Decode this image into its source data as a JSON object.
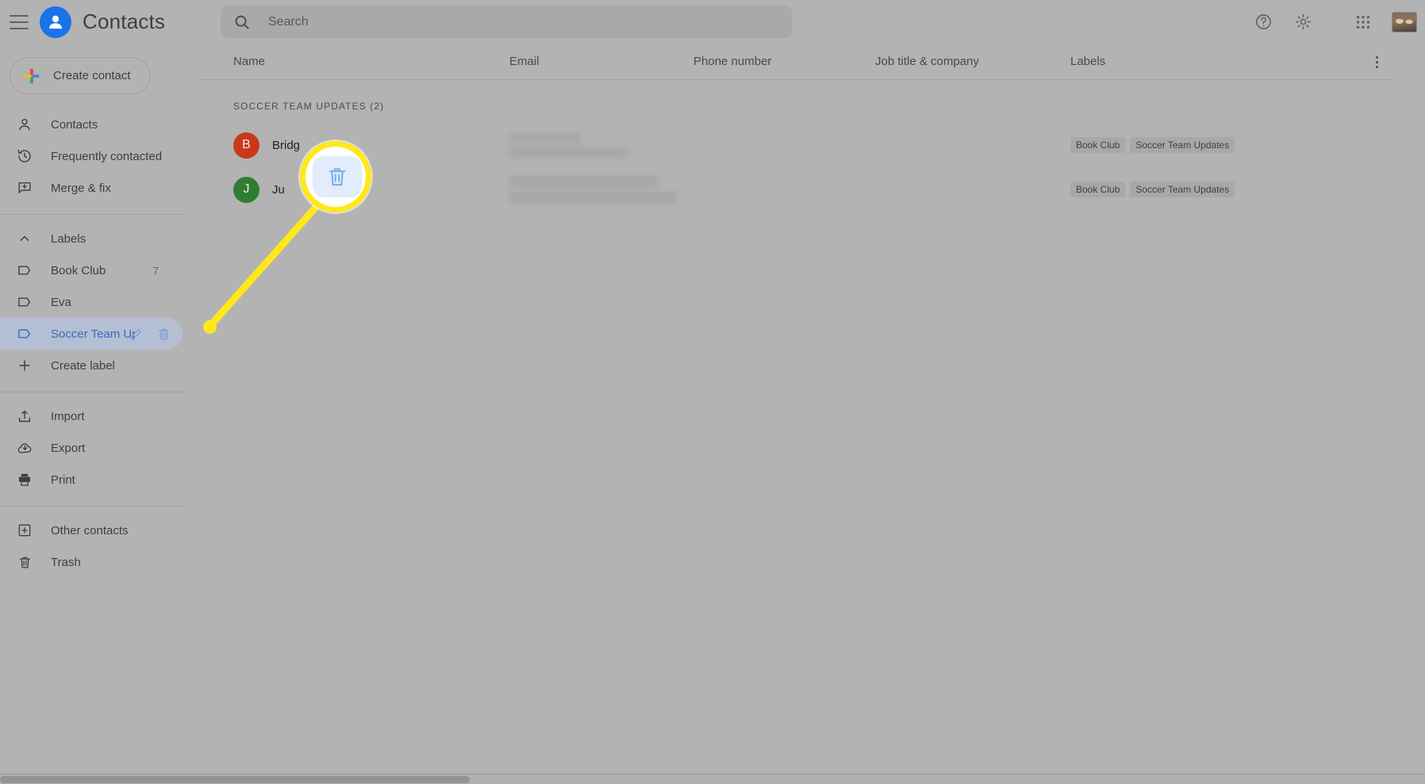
{
  "app": {
    "title": "Contacts",
    "brand_color": "#1a73e8"
  },
  "topbar": {
    "menu_icon": "hamburger-icon",
    "help_icon": "help-circle-icon",
    "settings_icon": "gear-icon",
    "apps_icon": "apps-grid-icon",
    "avatar_icon": "account-avatar"
  },
  "search": {
    "placeholder": "Search",
    "value": "",
    "icon": "search-icon"
  },
  "sidebar": {
    "create_contact_label": "Create contact",
    "nav": [
      {
        "label": "Contacts",
        "icon": "person-icon",
        "selected": false
      },
      {
        "label": "Frequently contacted",
        "icon": "history-clock-icon",
        "selected": false
      },
      {
        "label": "Merge & fix",
        "icon": "merge-fix-icon",
        "selected": false
      }
    ],
    "labels_header": {
      "label": "Labels",
      "icon": "chevron-up-icon"
    },
    "labels": [
      {
        "label": "Book Club",
        "count": "7",
        "selected": false
      },
      {
        "label": "Eva",
        "count": "",
        "selected": false
      },
      {
        "label": "Soccer Team Up",
        "count": "",
        "selected": true
      }
    ],
    "create_label": {
      "label": "Create label",
      "icon": "plus-icon"
    },
    "tools": [
      {
        "label": "Import",
        "icon": "import-icon"
      },
      {
        "label": "Export",
        "icon": "export-cloud-icon"
      },
      {
        "label": "Print",
        "icon": "printer-icon"
      }
    ],
    "footer": [
      {
        "label": "Other contacts",
        "icon": "other-contacts-icon"
      },
      {
        "label": "Trash",
        "icon": "trash-icon"
      }
    ],
    "label_row_actions": {
      "edit_icon": "pencil-icon",
      "delete_icon": "trash-icon"
    }
  },
  "table": {
    "columns": [
      "Name",
      "Email",
      "Phone number",
      "Job title & company",
      "Labels"
    ],
    "more_options_icon": "kebab-menu-icon",
    "group_header": "SOCCER TEAM UPDATES (2)",
    "rows": [
      {
        "initial": "B",
        "avatar_color": "#c9381b",
        "name": "Bridg",
        "email": "",
        "phone": "",
        "job": "",
        "labels": [
          "Book Club",
          "Soccer Team Updates"
        ]
      },
      {
        "initial": "J",
        "avatar_color": "#2e7d32",
        "name": "Ju",
        "email": "",
        "phone": "",
        "job": "",
        "labels": [
          "Book Club",
          "Soccer Team Updates"
        ]
      }
    ]
  },
  "callout": {
    "highlight_icon": "trash-icon",
    "ring_color": "#ffe81a",
    "icon_color": "#7aaeef"
  }
}
